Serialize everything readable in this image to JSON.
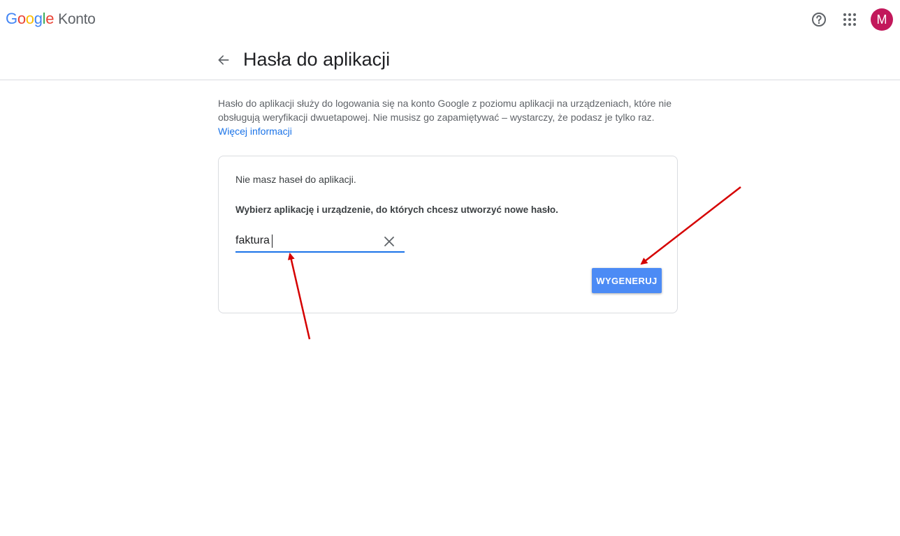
{
  "app": {
    "logo_parts": [
      {
        "text": "G",
        "color": "#4285F4"
      },
      {
        "text": "o",
        "color": "#EA4335"
      },
      {
        "text": "o",
        "color": "#FBBC05"
      },
      {
        "text": "g",
        "color": "#4285F4"
      },
      {
        "text": "l",
        "color": "#34A853"
      },
      {
        "text": "e",
        "color": "#EA4335"
      }
    ],
    "product": "Konto"
  },
  "topbar": {
    "help_icon": "help-circle-icon",
    "apps_icon": "apps-grid-icon",
    "avatar_letter": "M",
    "avatar_color": "#C2185B"
  },
  "header": {
    "back_icon": "arrow-back-icon",
    "title": "Hasła do aplikacji"
  },
  "description": {
    "text": "Hasło do aplikacji służy do logowania się na konto Google z poziomu aplikacji na urządzeniach, które nie obsługują weryfikacji dwuetapowej. Nie musisz go zapamiętywać – wystarczy, że podasz je tylko raz.",
    "link": "Więcej informacji"
  },
  "card": {
    "no_passwords": "Nie masz haseł do aplikacji.",
    "instruction": "Wybierz aplikację i urządzenie, do których chcesz utworzyć nowe hasło.",
    "input_value": "faktura",
    "clear_icon": "close-icon",
    "generate_label": "WYGENERUJ"
  },
  "colors": {
    "accent": "#1A73E8",
    "button": "#4C8BF5",
    "annotation_arrow": "#D50000"
  }
}
